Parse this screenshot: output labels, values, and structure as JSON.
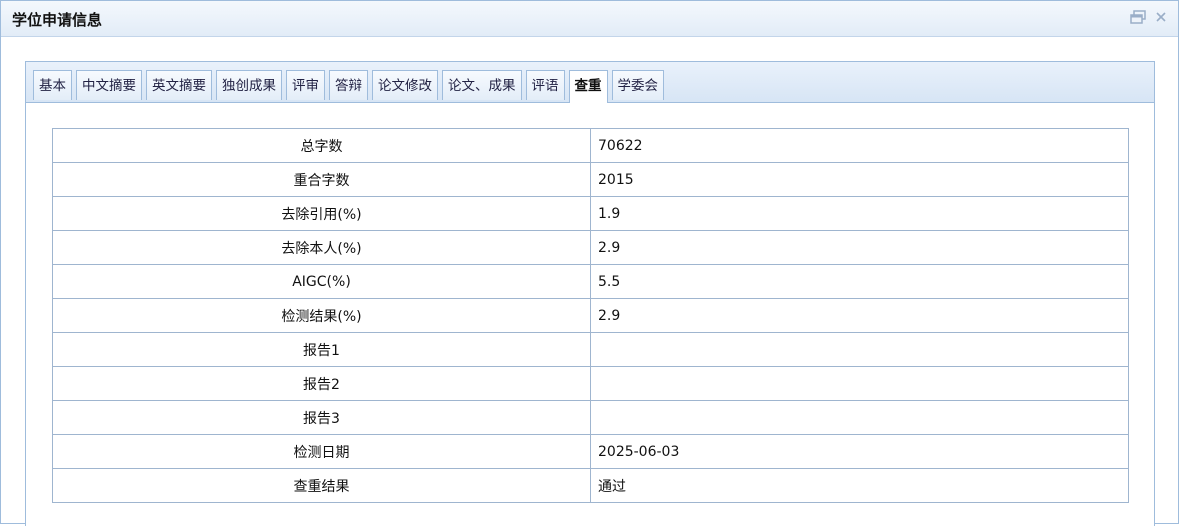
{
  "window": {
    "title": "学位申请信息",
    "icons": [
      "restore-icon",
      "close-icon"
    ]
  },
  "tabs": [
    {
      "label": "基本",
      "active": false
    },
    {
      "label": "中文摘要",
      "active": false
    },
    {
      "label": "英文摘要",
      "active": false
    },
    {
      "label": "独创成果",
      "active": false
    },
    {
      "label": "评审",
      "active": false
    },
    {
      "label": "答辩",
      "active": false
    },
    {
      "label": "论文修改",
      "active": false
    },
    {
      "label": "论文、成果",
      "active": false
    },
    {
      "label": "评语",
      "active": false
    },
    {
      "label": "查重",
      "active": true
    },
    {
      "label": "学委会",
      "active": false
    }
  ],
  "rows": [
    {
      "label": "总字数",
      "value": "70622"
    },
    {
      "label": "重合字数",
      "value": "2015"
    },
    {
      "label": "去除引用(%)",
      "value": "1.9"
    },
    {
      "label": "去除本人(%)",
      "value": "2.9"
    },
    {
      "label": "AIGC(%)",
      "value": "5.5"
    },
    {
      "label": "检测结果(%)",
      "value": "2.9"
    },
    {
      "label": "报告1",
      "value": ""
    },
    {
      "label": "报告2",
      "value": ""
    },
    {
      "label": "报告3",
      "value": ""
    },
    {
      "label": "检测日期",
      "value": "2025-06-03"
    },
    {
      "label": "查重结果",
      "value": "通过"
    }
  ],
  "colors": {
    "border": "#9fbcdc",
    "tabbar_bg": "#dbe7f5"
  }
}
